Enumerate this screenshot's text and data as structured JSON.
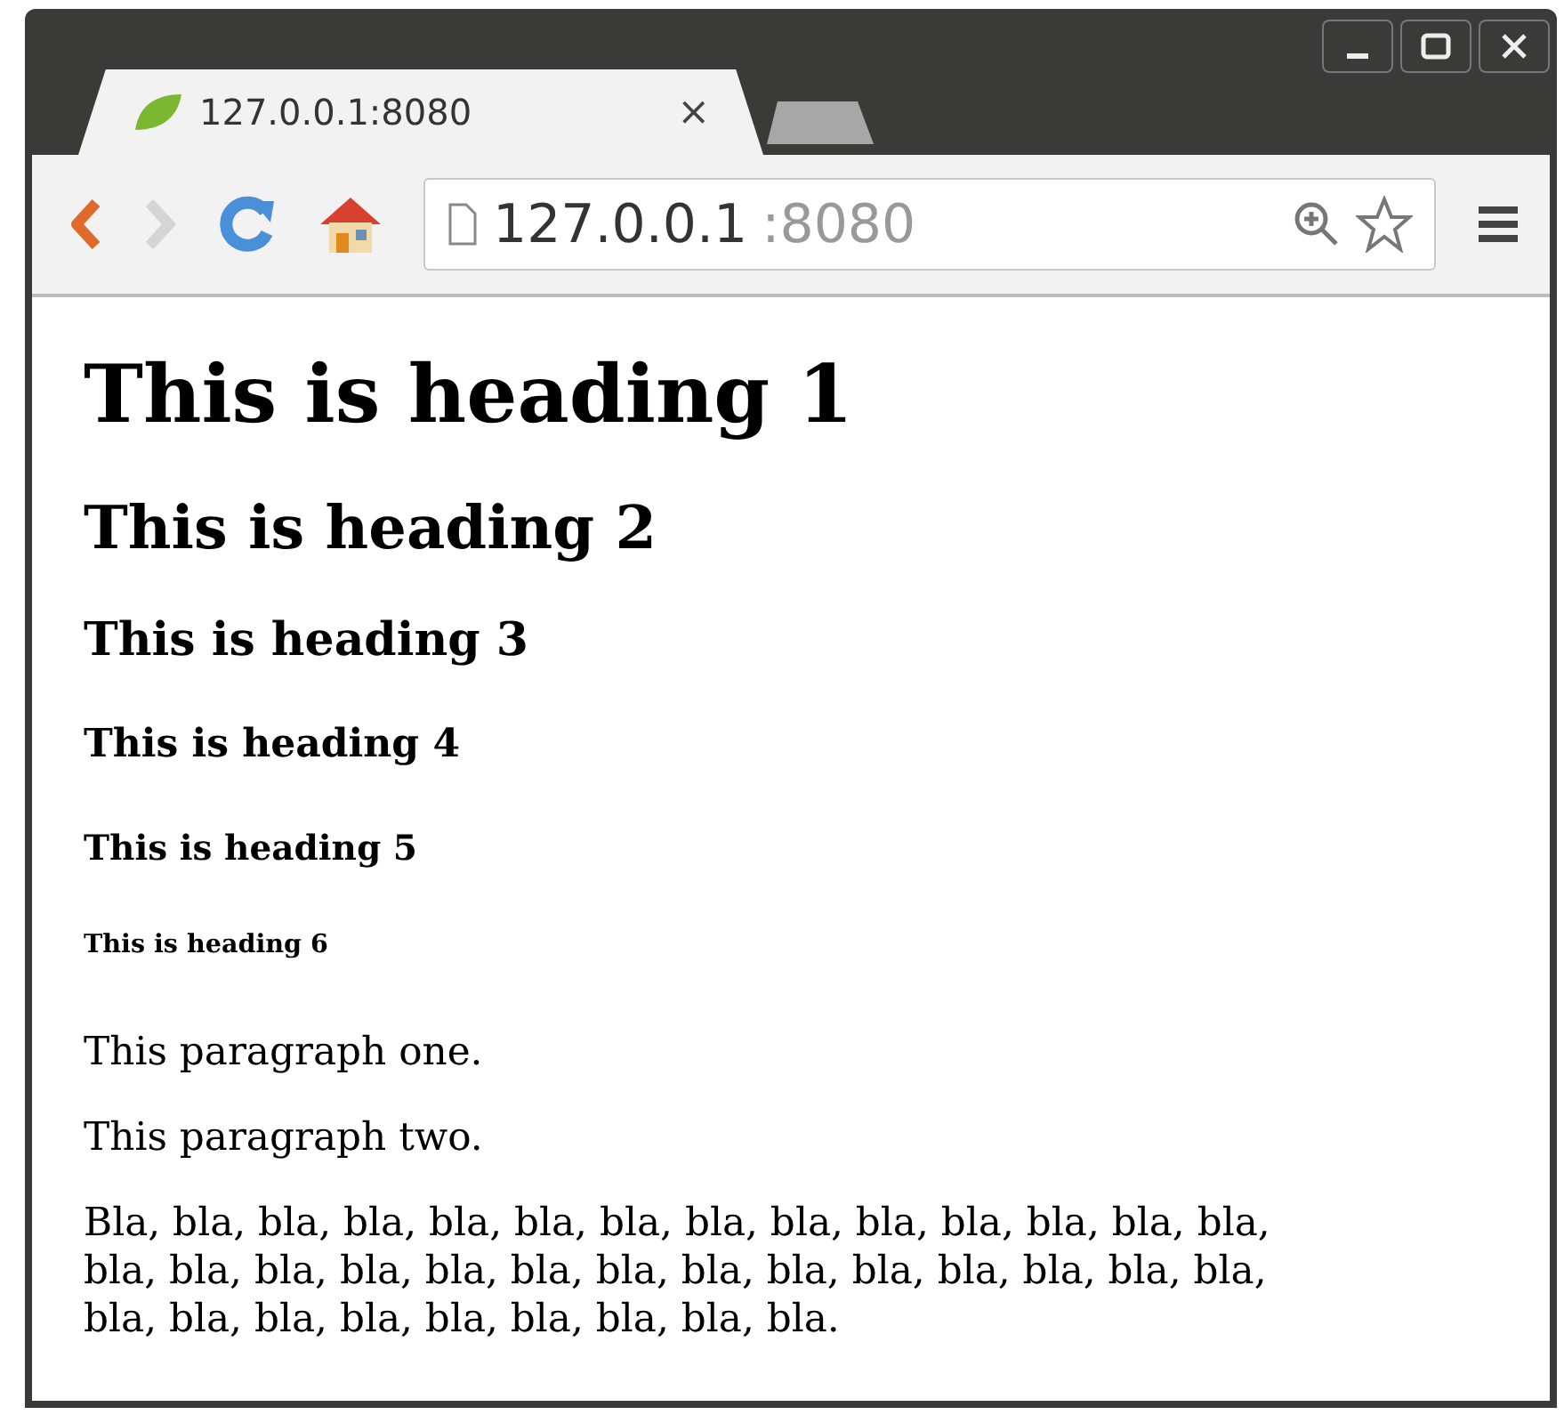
{
  "tabs": [
    {
      "title": "127.0.0.1:8080",
      "close": "×",
      "selected": true
    },
    {
      "selected": false
    }
  ],
  "address": {
    "host": "127.0.0.1",
    "port": ":8080"
  },
  "headings": [
    {
      "kind": "h1",
      "text": "This is heading 1"
    },
    {
      "kind": "h2",
      "text": "This is heading 2"
    },
    {
      "kind": "h3",
      "text": "This is heading 3"
    },
    {
      "kind": "h4",
      "text": "This is heading 4"
    },
    {
      "kind": "h5",
      "text": "This is heading 5"
    },
    {
      "kind": "h6",
      "text": "This is heading 6"
    }
  ],
  "paragraphs": [
    "This paragraph one.",
    "This paragraph two.",
    "Bla, bla, bla, bla, bla, bla, bla, bla, bla, bla, bla, bla, bla, bla, bla, bla, bla, bla, bla, bla, bla, bla, bla, bla, bla, bla, bla, bla, bla, bla, bla, bla, bla, bla, bla, bla, bla."
  ]
}
